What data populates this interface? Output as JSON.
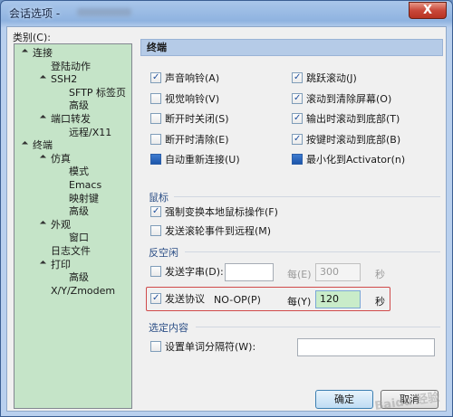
{
  "window": {
    "title": "会话选项 -",
    "close_label": "X"
  },
  "category_label": "类别(C):",
  "tree": [
    {
      "label": "连接",
      "level": 0
    },
    {
      "label": "登陆动作",
      "level": 1
    },
    {
      "label": "SSH2",
      "level": 1
    },
    {
      "label": "SFTP 标签页",
      "level": 2
    },
    {
      "label": "高级",
      "level": 2
    },
    {
      "label": "端口转发",
      "level": 1
    },
    {
      "label": "远程/X11",
      "level": 2
    },
    {
      "label": "终端",
      "level": 0
    },
    {
      "label": "仿真",
      "level": 1
    },
    {
      "label": "模式",
      "level": 2
    },
    {
      "label": "Emacs",
      "level": 2
    },
    {
      "label": "映射键",
      "level": 2
    },
    {
      "label": "高级",
      "level": 2
    },
    {
      "label": "外观",
      "level": 1
    },
    {
      "label": "窗口",
      "level": 2
    },
    {
      "label": "日志文件",
      "level": 1
    },
    {
      "label": "打印",
      "level": 1
    },
    {
      "label": "高级",
      "level": 2
    },
    {
      "label": "X/Y/Zmodem",
      "level": 1
    }
  ],
  "section_title": "终端",
  "terminal_options": {
    "left": [
      {
        "label": "声音响铃(A)",
        "checked": true
      },
      {
        "label": "视觉响铃(V)",
        "checked": false
      },
      {
        "label": "断开时关闭(S)",
        "checked": false
      },
      {
        "label": "断开时清除(E)",
        "checked": false
      },
      {
        "label": "自动重新连接(U)",
        "checked": "filled"
      }
    ],
    "right": [
      {
        "label": "跳跃滚动(J)",
        "checked": true
      },
      {
        "label": "滚动到清除屏幕(O)",
        "checked": true
      },
      {
        "label": "输出时滚动到底部(T)",
        "checked": true
      },
      {
        "label": "按键时滚动到底部(B)",
        "checked": true
      },
      {
        "label": "最小化到Activator(n)",
        "checked": "filled"
      }
    ]
  },
  "mouse": {
    "title": "鼠标",
    "options": [
      {
        "label": "强制变换本地鼠标操作(F)",
        "checked": true
      },
      {
        "label": "发送滚轮事件到远程(M)",
        "checked": false
      }
    ]
  },
  "anti_idle": {
    "title": "反空闲",
    "send_string_label": "发送字串(D):",
    "send_string_value": "",
    "every_label": "每(E)",
    "every_value": "300",
    "seconds_label": "秒",
    "send_protocol_label": "发送协议",
    "protocol_value": "NO-OP(P)",
    "every2_label": "每(Y)",
    "every2_value": "120",
    "seconds2_label": "秒"
  },
  "selection": {
    "title": "选定内容",
    "word_delimiters_label": "设置单词分隔符(W):",
    "word_delimiters_value": ""
  },
  "buttons": {
    "ok": "确定",
    "cancel": "取消"
  },
  "watermark": "Baidu 经验"
}
